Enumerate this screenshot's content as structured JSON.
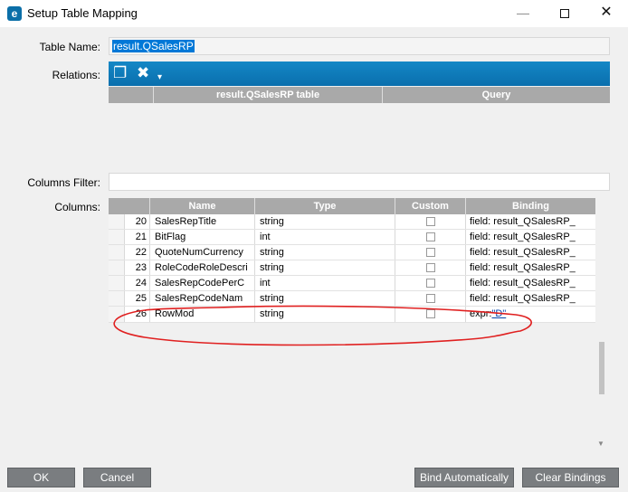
{
  "window": {
    "app_icon": "e",
    "title": "Setup Table Mapping",
    "minimize_icon": "minimize-icon",
    "maximize_icon": "maximize-icon",
    "close_icon": "close-icon",
    "close_glyph": "✕"
  },
  "form": {
    "table_name_label": "Table Name:",
    "table_name_value": "result.QSalesRP",
    "relations_label": "Relations:",
    "columns_filter_label": "Columns Filter:",
    "columns_filter_value": "",
    "columns_label": "Columns:"
  },
  "relations": {
    "toolbar_icons": [
      "new-icon",
      "delete-icon",
      "dropdown-icon"
    ],
    "new_glyph": "❐",
    "delete_glyph": "✖",
    "dropdown_glyph": "▾",
    "headers": [
      "result.QSalesRP table",
      "Query"
    ],
    "rows": []
  },
  "columns_grid": {
    "headers": {
      "name": "Name",
      "type": "Type",
      "custom": "Custom",
      "binding": "Binding"
    },
    "rows": [
      {
        "num": "20",
        "name": "SalesRepTitle",
        "type": "string",
        "binding": "field: result_QSalesRP_"
      },
      {
        "num": "21",
        "name": "BitFlag",
        "type": "int",
        "binding": "field: result_QSalesRP_"
      },
      {
        "num": "22",
        "name": "QuoteNumCurrency",
        "type": "string",
        "binding": "field: result_QSalesRP_"
      },
      {
        "num": "23",
        "name": "RoleCodeRoleDescri",
        "type": "string",
        "binding": "field: result_QSalesRP_"
      },
      {
        "num": "24",
        "name": "SalesRepCodePerC",
        "type": "int",
        "binding": "field: result_QSalesRP_"
      },
      {
        "num": "25",
        "name": "SalesRepCodeNam",
        "type": "string",
        "binding": "field: result_QSalesRP_"
      },
      {
        "num": "26",
        "name": "RowMod",
        "type": "string",
        "binding_prefix": "expr:",
        "binding_link": "\"D\""
      }
    ],
    "scroll_arrow_glyph": "▼"
  },
  "buttons": {
    "ok": "OK",
    "cancel": "Cancel",
    "bind_automatically": "Bind Automatically",
    "clear_bindings": "Clear Bindings"
  },
  "colors": {
    "toolbar_blue": "#0a6fad",
    "header_gray": "#a9a9a9",
    "selection_blue": "#0078d7",
    "annotation_red": "#e02020",
    "button_gray": "#7a7d80"
  }
}
